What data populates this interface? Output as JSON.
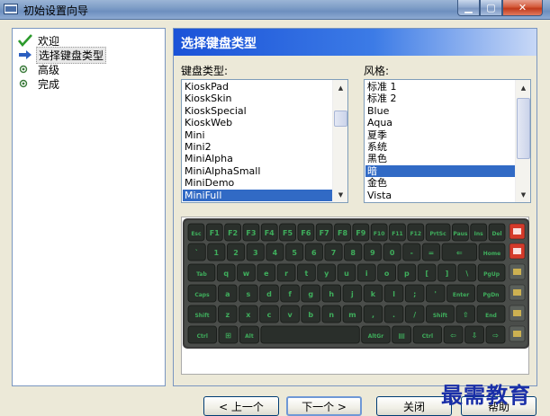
{
  "window": {
    "title": "初始设置向导",
    "min_glyph": "▁",
    "max_glyph": "▢",
    "close_glyph": "✕"
  },
  "steps": [
    {
      "label": "欢迎",
      "icon": "check-icon"
    },
    {
      "label": "选择键盘类型",
      "icon": "arrow-right-icon"
    },
    {
      "label": "高级",
      "icon": "bullet-icon"
    },
    {
      "label": "完成",
      "icon": "bullet-icon"
    }
  ],
  "main": {
    "header": "选择键盘类型",
    "keyboard_type_label": "键盘类型:",
    "style_label": "风格:",
    "keyboard_types": [
      "KioskPad",
      "KioskSkin",
      "KioskSpecial",
      "KioskWeb",
      "Mini",
      "Mini2",
      "MiniAlpha",
      "MiniAlphaSmall",
      "MiniDemo",
      "MiniFull"
    ],
    "keyboard_selected": "MiniFull",
    "styles": [
      "标准 1",
      "标准 2",
      "Blue",
      "Aqua",
      "夏季",
      "系统",
      "黑色",
      "暗",
      "金色",
      "Vista"
    ],
    "style_selected": "暗"
  },
  "keyboard_preview": {
    "rows": [
      [
        "Esc",
        "F1",
        "F2",
        "F3",
        "F4",
        "F5",
        "F6",
        "F7",
        "F8",
        "F9",
        "F10",
        "F11",
        "F12",
        "PrtSc",
        "Paus",
        "Ins",
        "Del"
      ],
      [
        "`",
        "1",
        "2",
        "3",
        "4",
        "5",
        "6",
        "7",
        "8",
        "9",
        "0",
        "-",
        "=",
        "⇐",
        "Home"
      ],
      [
        "Tab",
        "q",
        "w",
        "e",
        "r",
        "t",
        "y",
        "u",
        "i",
        "o",
        "p",
        "[",
        "]",
        "\\",
        "PgUp"
      ],
      [
        "Caps",
        "a",
        "s",
        "d",
        "f",
        "g",
        "h",
        "j",
        "k",
        "l",
        ";",
        "'",
        "Enter",
        "PgDn"
      ],
      [
        "Shift",
        "z",
        "x",
        "c",
        "v",
        "b",
        "n",
        "m",
        ",",
        ".",
        "/",
        "Shift",
        "⇧",
        "End"
      ],
      [
        "Ctrl",
        "⊞",
        "Alt",
        "",
        "AltGr",
        "▤",
        "Ctrl",
        "⇦",
        "⇩",
        "⇨"
      ]
    ],
    "colors": {
      "frame": "#3a3a3a",
      "key": "#2a2f2b",
      "key_text": "#3fae5c",
      "accent_red": "#d43a2a"
    }
  },
  "buttons": {
    "back": "< 上一个",
    "next": "下一个 >",
    "close": "关闭",
    "help": "帮助"
  },
  "watermark": "最需教育"
}
